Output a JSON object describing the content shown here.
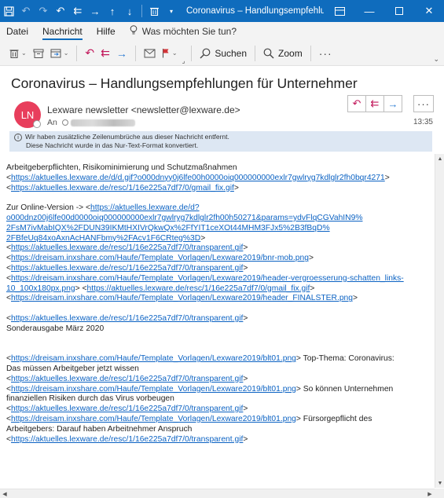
{
  "titlebar": {
    "title": "Coronavirus – Handlungsempfehlunge...",
    "icons": [
      "save-icon",
      "undo-icon",
      "redo-icon",
      "reply-icon",
      "reply-all-icon",
      "forward-icon",
      "up-icon",
      "down-icon",
      "delete-icon",
      "more-qat-icon"
    ]
  },
  "menu": {
    "items": [
      "Datei",
      "Nachricht",
      "Hilfe"
    ],
    "active": "Nachricht",
    "tellme": "Was möchten Sie tun?"
  },
  "ribbon": {
    "search_label": "Suchen",
    "zoom_label": "Zoom",
    "more": "···"
  },
  "message": {
    "subject": "Coronavirus – Handlungsempfehlungen für Unternehmer",
    "avatar_initials": "LN",
    "sender": "Lexware newsletter <newsletter@lexware.de>",
    "to_label": "An",
    "time": "13:35",
    "more": "···",
    "info_line1": "Wir haben zusätzliche Zeilenumbrüche aus dieser Nachricht entfernt.",
    "info_line2": "Diese Nachricht wurde in das Nur-Text-Format konvertiert."
  },
  "body": {
    "line01": "Arbeitgeberpflichten, Risikominimierung und Schutzmaßnahmen",
    "line02_pre": "  <",
    "line02_link": "https://aktuelles.lexware.de/d/d.gif?o000dnyy0j6lfe00h0000oiq000000000exlr7gwlryg7kdlglr2fh0bqr4271",
    "line02_post": ">",
    "line03_pre": "<",
    "line03_link": "https://aktuelles.lexware.de/resc/1/16e225a7df7/0/gmail_fix.gif",
    "line03_post": ">",
    "line05_pre": "Zur Online-Version -> <",
    "line05_link": "https://aktuelles.lexware.de/d?",
    "line06_link": "o000dnz00j6lfe00d0000oiq000000000exlr7gwlryg7kdlglr2fh00h50271&params=ydvFlqCGVahIN9%",
    "line07_link": "2FsM7ivMabIQX%2FDUN39IKMtHXIVrQkwQx%2FfYIT1ceXOt44MHM3FJx5%2B3fBqD%",
    "line08_link": "2FBfeUq84xoAxnAcHANFbmy%2FAcv1F6CRteg%3D",
    "line08_post": ">",
    "line09_pre": " <",
    "line09_link": "https://aktuelles.lexware.de/resc/1/16e225a7df7/0/transparent.gif",
    "line09_post": ">",
    "line10_pre": " <",
    "line10_link": "https://dreisam.inxshare.com/Haufe/Template_Vorlagen/Lexware2019/bnr-mob.png",
    "line10_post": ">",
    "line11_pre": " <",
    "line11_link": "https://aktuelles.lexware.de/resc/1/16e225a7df7/0/transparent.gif",
    "line11_post": ">",
    "line12_pre": " <",
    "line12_link": "https://dreisam.inxshare.com/Haufe/Template_Vorlagen/Lexware2019/header-vergroesserung-schatten_links-",
    "line13_link": "10_100x180px.png",
    "line13_mid": ">  <",
    "line13_link2": "https://aktuelles.lexware.de/resc/1/16e225a7df7/0/gmail_fix.gif",
    "line13_post": ">",
    "line14_pre": "<",
    "line14_link": "https://dreisam.inxshare.com/Haufe/Template_Vorlagen/Lexware2019/header_FINALSTER.png",
    "line14_post": ">",
    "line16_pre": " <",
    "line16_link": "https://aktuelles.lexware.de/resc/1/16e225a7df7/0/transparent.gif",
    "line16_post": ">",
    "line17": "Sonderausgabe März 2020",
    "line20_pre": " <",
    "line20_link": "https://dreisam.inxshare.com/Haufe/Template_Vorlagen/Lexware2019/blt01.png",
    "line20_post": ">   Top-Thema: Coronavirus:",
    "line21": "Das müssen Arbeitgeber jetzt wissen",
    "line22_pre": " <",
    "line22_link": "https://aktuelles.lexware.de/resc/1/16e225a7df7/0/transparent.gif",
    "line22_post": ">",
    "line23_pre": " <",
    "line23_link": "https://dreisam.inxshare.com/Haufe/Template_Vorlagen/Lexware2019/blt01.png",
    "line23_post": ">   So können Unternehmen",
    "line24": "finanziellen Risiken durch das Virus vorbeugen",
    "line25_pre": " <",
    "line25_link": "https://aktuelles.lexware.de/resc/1/16e225a7df7/0/transparent.gif",
    "line25_post": ">",
    "line26_pre": " <",
    "line26_link": "https://dreisam.inxshare.com/Haufe/Template_Vorlagen/Lexware2019/blt01.png",
    "line26_post": ">   Fürsorgepflicht des",
    "line27": "Arbeitgebers: Darauf haben Arbeitnehmer Anspruch",
    "line28_pre": " <",
    "line28_link": "https://aktuelles.lexware.de/resc/1/16e225a7df7/0/transparent.gif",
    "line28_post": ">"
  },
  "colors": {
    "titlebar": "#0f6cbd",
    "link": "#0b62c3",
    "avatar": "#e83e5c",
    "info_bg": "#dde7f3"
  }
}
